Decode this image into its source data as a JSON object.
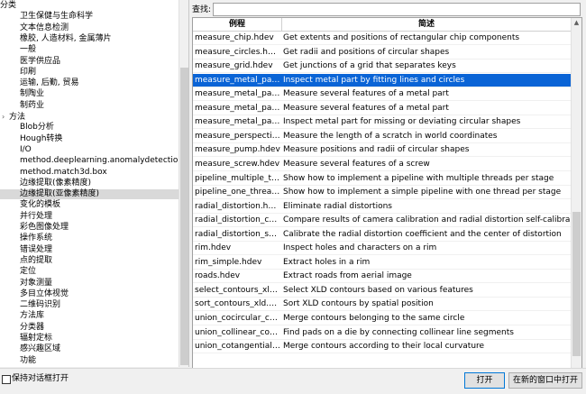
{
  "tree": {
    "rows": [
      {
        "label": "分类",
        "indent": 0,
        "twisty": "",
        "selected": false
      },
      {
        "label": "卫生保健与生命科学",
        "indent": 22,
        "twisty": "",
        "selected": false
      },
      {
        "label": "文本信息检测",
        "indent": 22,
        "twisty": "",
        "selected": false
      },
      {
        "label": "橡胶, 人造材料, 金属薄片",
        "indent": 22,
        "twisty": "",
        "selected": false
      },
      {
        "label": "一般",
        "indent": 22,
        "twisty": "",
        "selected": false
      },
      {
        "label": "医学供应品",
        "indent": 22,
        "twisty": "",
        "selected": false
      },
      {
        "label": "印刷",
        "indent": 22,
        "twisty": "",
        "selected": false
      },
      {
        "label": "运输, 后勤, 贸易",
        "indent": 22,
        "twisty": "",
        "selected": false
      },
      {
        "label": "制陶业",
        "indent": 22,
        "twisty": "",
        "selected": false
      },
      {
        "label": "制药业",
        "indent": 22,
        "twisty": "",
        "selected": false
      },
      {
        "label": "方法",
        "indent": 2,
        "twisty": "›",
        "selected": false
      },
      {
        "label": "Blob分析",
        "indent": 22,
        "twisty": "",
        "selected": false
      },
      {
        "label": "Hough转换",
        "indent": 22,
        "twisty": "",
        "selected": false
      },
      {
        "label": "I/O",
        "indent": 22,
        "twisty": "",
        "selected": false
      },
      {
        "label": "method.deeplearning.anomalydetection",
        "indent": 22,
        "twisty": "",
        "selected": false
      },
      {
        "label": "method.match3d.box",
        "indent": 22,
        "twisty": "",
        "selected": false
      },
      {
        "label": "边缘提取(像素精度)",
        "indent": 22,
        "twisty": "",
        "selected": false
      },
      {
        "label": "边缘提取(亚像素精度)",
        "indent": 22,
        "twisty": "",
        "selected": true
      },
      {
        "label": "变化的模板",
        "indent": 22,
        "twisty": "",
        "selected": false
      },
      {
        "label": "并行处理",
        "indent": 22,
        "twisty": "",
        "selected": false
      },
      {
        "label": "彩色图像处理",
        "indent": 22,
        "twisty": "",
        "selected": false
      },
      {
        "label": "操作系统",
        "indent": 22,
        "twisty": "",
        "selected": false
      },
      {
        "label": "错误处理",
        "indent": 22,
        "twisty": "",
        "selected": false
      },
      {
        "label": "点的提取",
        "indent": 22,
        "twisty": "",
        "selected": false
      },
      {
        "label": "定位",
        "indent": 22,
        "twisty": "",
        "selected": false
      },
      {
        "label": "对象测量",
        "indent": 22,
        "twisty": "",
        "selected": false
      },
      {
        "label": "多目立体视觉",
        "indent": 22,
        "twisty": "",
        "selected": false
      },
      {
        "label": "二维码识别",
        "indent": 22,
        "twisty": "",
        "selected": false
      },
      {
        "label": "方法库",
        "indent": 22,
        "twisty": "",
        "selected": false
      },
      {
        "label": "分类器",
        "indent": 22,
        "twisty": "",
        "selected": false
      },
      {
        "label": "辐射定标",
        "indent": 22,
        "twisty": "",
        "selected": false
      },
      {
        "label": "感兴趣区域",
        "indent": 22,
        "twisty": "",
        "selected": false
      },
      {
        "label": "功能",
        "indent": 22,
        "twisty": "",
        "selected": false
      }
    ]
  },
  "search": {
    "label": "查找:",
    "value": ""
  },
  "table": {
    "headers": [
      "例程",
      "简述"
    ],
    "rows": [
      {
        "name": "measure_chip.hdev",
        "desc": "Get extents and positions of rectangular chip components",
        "selected": false
      },
      {
        "name": "measure_circles.hdev",
        "desc": "Get radii and positions of circular shapes",
        "selected": false
      },
      {
        "name": "measure_grid.hdev",
        "desc": "Get junctions of a grid that separates keys",
        "selected": false
      },
      {
        "name": "measure_metal_part.hdev",
        "desc": "Inspect metal part by fitting lines and circles",
        "selected": true
      },
      {
        "name": "measure_metal_part_ext...",
        "desc": "Measure several features of a metal part",
        "selected": false
      },
      {
        "name": "measure_metal_part_firs...",
        "desc": "Measure several features of a metal part",
        "selected": false
      },
      {
        "name": "measure_metal_part_id....",
        "desc": "Inspect metal part for missing or deviating circular shapes",
        "selected": false
      },
      {
        "name": "measure_perspective_sc...",
        "desc": "Measure the length of a scratch in world coordinates",
        "selected": false
      },
      {
        "name": "measure_pump.hdev",
        "desc": "Measure positions and radii of circular shapes",
        "selected": false
      },
      {
        "name": "measure_screw.hdev",
        "desc": "Measure several features of a screw",
        "selected": false
      },
      {
        "name": "pipeline_multiple_thread...",
        "desc": "Show how to implement a pipeline with multiple threads per stage",
        "selected": false
      },
      {
        "name": "pipeline_one_thread_pe...",
        "desc": "Show how to implement a simple pipeline with one thread per stage",
        "selected": false
      },
      {
        "name": "radial_distortion.hdev",
        "desc": "Eliminate radial distortions",
        "selected": false
      },
      {
        "name": "radial_distortion_compa...",
        "desc": "Compare results of camera calibration and radial distortion self-calibration",
        "selected": false
      },
      {
        "name": "radial_distortion_self_cal...",
        "desc": "Calibrate the radial distortion coefficient and the center of distortion",
        "selected": false
      },
      {
        "name": "rim.hdev",
        "desc": "Inspect holes and characters on a rim",
        "selected": false
      },
      {
        "name": "rim_simple.hdev",
        "desc": "Extract holes in a rim",
        "selected": false
      },
      {
        "name": "roads.hdev",
        "desc": "Extract roads from aerial image",
        "selected": false
      },
      {
        "name": "select_contours_xld.hdev",
        "desc": "Select XLD contours based on various features",
        "selected": false
      },
      {
        "name": "sort_contours_xld.hdev",
        "desc": "Sort XLD contours by spatial position",
        "selected": false
      },
      {
        "name": "union_cocircular_contou...",
        "desc": "Merge contours belonging to the same circle",
        "selected": false
      },
      {
        "name": "union_collinear_contour...",
        "desc": "Find pads on a die by connecting collinear line segments",
        "selected": false
      },
      {
        "name": "union_cotangential_cont...",
        "desc": "Merge contours according to their local curvature",
        "selected": false
      }
    ]
  },
  "bottom": {
    "keep_open_label": "保持对话框打开",
    "open_label": "打开",
    "open_new_label": "在新的窗口中打开"
  },
  "colors": {
    "selection": "#0a64d6",
    "tree_selection": "#d9d9d9"
  }
}
